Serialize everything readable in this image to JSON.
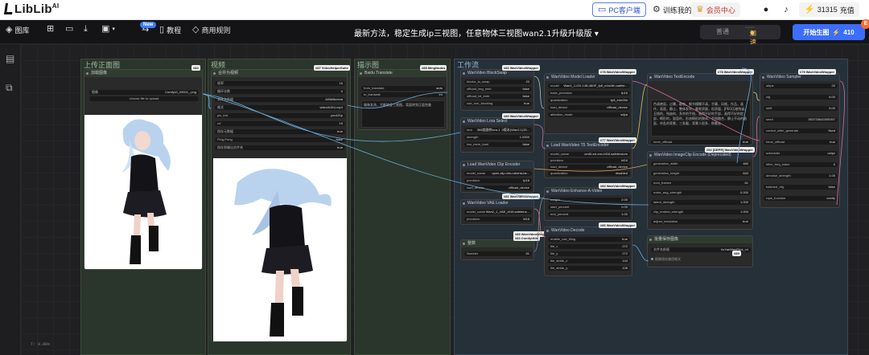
{
  "topbar": {
    "logo": "LibLib",
    "logo_sup": "AI",
    "pc_client": "PC客户端",
    "train_lora": "训练我的LoRA",
    "vip_center": "会员中心",
    "points": "31315",
    "recharge": "充值"
  },
  "toolbar": {
    "library": "图库",
    "new_badge": "New",
    "tutorial": "教程",
    "commercial_rules": "商用规则",
    "title": "最新方法，稳定生成ip三视图，任意物体三视图wan2.1升级升级版",
    "mode_normal": "普通",
    "mode_fast": "加速",
    "generate_label": "开始生图",
    "generate_count": "410",
    "notification_count": "E"
  },
  "canvas": {
    "coords": "T: 0.00s",
    "groups": [
      {
        "label": "上传正面图"
      },
      {
        "label": "视频"
      },
      {
        "label": "描示图"
      },
      {
        "label": "工作流"
      }
    ],
    "nodes": {
      "load_image": {
        "badge": "#84",
        "title": "加载图像",
        "row1_label": "图像",
        "row1_value": "ComfyUI_00001_.png",
        "row2": "choose file to upload"
      },
      "video_combine": {
        "badge": "#87 VideoHelperSuite",
        "title": "合并为视频",
        "rows": [
          {
            "label": "帧率",
            "value": "16"
          },
          {
            "label": "循环次数",
            "value": "0"
          },
          {
            "label": "文件名前缀",
            "value": "AI\\liblibcreat"
          },
          {
            "label": "格式",
            "value": "video/h264-mp4"
          },
          {
            "label": "pix_fmt",
            "value": "yuv420p"
          },
          {
            "label": "crf",
            "value": "19"
          },
          {
            "label": "保存元数据",
            "value": "true"
          },
          {
            "label": "Ping-Pong",
            "value": "false"
          },
          {
            "label": "保存到输出文件夹",
            "value": "true"
          }
        ]
      },
      "mingnodes": {
        "badge": "#88 MingNodes",
        "title": "Baidu Translate",
        "row1_label": "from_translate",
        "row1_value": "auto",
        "row2_label": "to_translate",
        "row2_value": "en",
        "text": "服装女孩，不断转身三视图，背面转到正面完美"
      },
      "block_swap": {
        "badge": "#82 WanVideoWrapper",
        "title": "WanVideo BlockSwap",
        "rows": [
          {
            "label": "blocks_to_swap",
            "value": "20"
          },
          {
            "label": "offload_img_emb",
            "value": "false"
          },
          {
            "label": "offload_txt_emb",
            "value": "false"
          },
          {
            "label": "use_non_blocking",
            "value": "true"
          }
        ]
      },
      "model_loader": {
        "badge": "#78 WanVideoWrapper",
        "title": "WanVideo Model Loader",
        "rows": [
          {
            "label": "model",
            "value": "Wan2_1-I2V-14B-480P_fp8_e4m3fn.safete..."
          },
          {
            "label": "base_precision",
            "value": "fp16"
          },
          {
            "label": "quantization",
            "value": "fp8_e4m3fn"
          },
          {
            "label": "load_device",
            "value": "offload_device"
          },
          {
            "label": "attention_mode",
            "value": "sdpa"
          }
        ]
      },
      "lora_select": {
        "badge": "#80 WanVideoWrapper",
        "title": "WanVideo Lora Select",
        "rows": [
          {
            "label": "lora",
            "value": "360度旋转lora-1 .0版本(Wan2.1)33..."
          },
          {
            "label": "strength",
            "value": "1.0000"
          },
          {
            "label": "low_mem_load",
            "value": "false"
          }
        ]
      },
      "t5_encoder": {
        "badge": "#77 WanVideoWrapper",
        "title": "Load WanVideo T5 TextEncoder",
        "rows": [
          {
            "label": "model_name",
            "value": "umt5-xxl-enc-bf16.safetensors"
          },
          {
            "label": "precision",
            "value": "bf16"
          },
          {
            "label": "load_device",
            "value": "offload_device"
          },
          {
            "label": "quantization",
            "value": "disabled"
          }
        ]
      },
      "clip_encoder": {
        "badge": "#81 WanVideoWrapper",
        "title": "Load WanVideo Clip Encoder",
        "rows": [
          {
            "label": "model_name",
            "value": "open-clip-xlm-roberta-lar..."
          },
          {
            "label": "precision",
            "value": "fp16"
          },
          {
            "label": "load_device",
            "value": "offload_device"
          }
        ]
      },
      "enhance_video": {
        "badge": "#83 WanVideoWrapper",
        "title": "WanVideo Enhance-A-Video",
        "rows": [
          {
            "label": "weight",
            "value": "2.00"
          },
          {
            "label": "start_percent",
            "value": "0.00"
          },
          {
            "label": "end_percent",
            "value": "1.00"
          }
        ]
      },
      "vae_loader": {
        "badge": "#85 WanVideoWrapper",
        "title": "WanVideo VAE Loader",
        "rows": [
          {
            "label": "model_name",
            "value": "Wan2_1_VAE_bf16.safetens..."
          },
          {
            "label": "precision",
            "value": "bf16"
          }
        ]
      },
      "decode": {
        "badge": "#86 WanVideoWrapper",
        "title": "WanVideo Decode",
        "rows": [
          {
            "label": "enable_vae_tiling",
            "value": "true"
          },
          {
            "label": "tile_x",
            "value": "272"
          },
          {
            "label": "tile_y",
            "value": "272"
          },
          {
            "label": "tile_stride_x",
            "value": "144"
          },
          {
            "label": "tile_stride_y",
            "value": "128"
          }
        ]
      },
      "int_node": {
        "badge": "#83 ComfyUtils",
        "title": "整数",
        "row_label": "Number",
        "row_value": "81"
      },
      "text_encode": {
        "badge": "#78 WanVideoWrapper",
        "title": "WanVideo TextEncode",
        "text": "色调艳丽，过曝，静态，细节模糊不清，字幕，风格，作品，画作，画面，静止，整体发灰，最差质量，低质量，JPEG压缩残留，丑陋的，残缺的，多余的手指，画得不好的手部，画得不好的脸部，畸形的，毁容的，形态畸形的肢体，手指融合，静止不动的画面，杂乱的背景，三条腿，背景人很多，倒着走",
        "row_label": "force_offload",
        "row_value": "true"
      },
      "imageclip": {
        "badge": "#92 [DEPR] WanVideoWrapper",
        "title": "WanVideo ImageClip Encode (Deprecated)",
        "rows": [
          {
            "label": "generation_width",
            "value": "480"
          },
          {
            "label": "generation_height",
            "value": "640"
          },
          {
            "label": "num_frames",
            "value": "81"
          },
          {
            "label": "noise_aug_strength",
            "value": "0.000"
          },
          {
            "label": "latent_strength",
            "value": "1.000"
          },
          {
            "label": "clip_embed_strength",
            "value": "1.000"
          },
          {
            "label": "adjust_resolution",
            "value": "true"
          }
        ]
      },
      "sampler": {
        "badge": "#79 WanVideoWrapper",
        "title": "WanVideo Sampler",
        "rows": [
          {
            "label": "steps",
            "value": "20"
          },
          {
            "label": "cfg",
            "value": "6.00"
          },
          {
            "label": "shift",
            "value": "5.00"
          },
          {
            "label": "seed",
            "value": "503733643305397"
          },
          {
            "label": "control_after_generate",
            "value": "fixed"
          },
          {
            "label": "force_offload",
            "value": "true"
          },
          {
            "label": "scheduler",
            "value": "unipc"
          },
          {
            "label": "riflex_freq_index",
            "value": "0"
          },
          {
            "label": "denoise_strength",
            "value": "1.00"
          },
          {
            "label": "batched_cfg",
            "value": "false"
          },
          {
            "label": "rope_function",
            "value": "comfy"
          }
        ]
      },
      "file_save": {
        "badge": "#89",
        "title": "批量保存图像",
        "row1_label": "文件名前缀",
        "row1_value": "liuYanWenPrint_v4",
        "row2": "图像保存路径格式"
      }
    }
  }
}
